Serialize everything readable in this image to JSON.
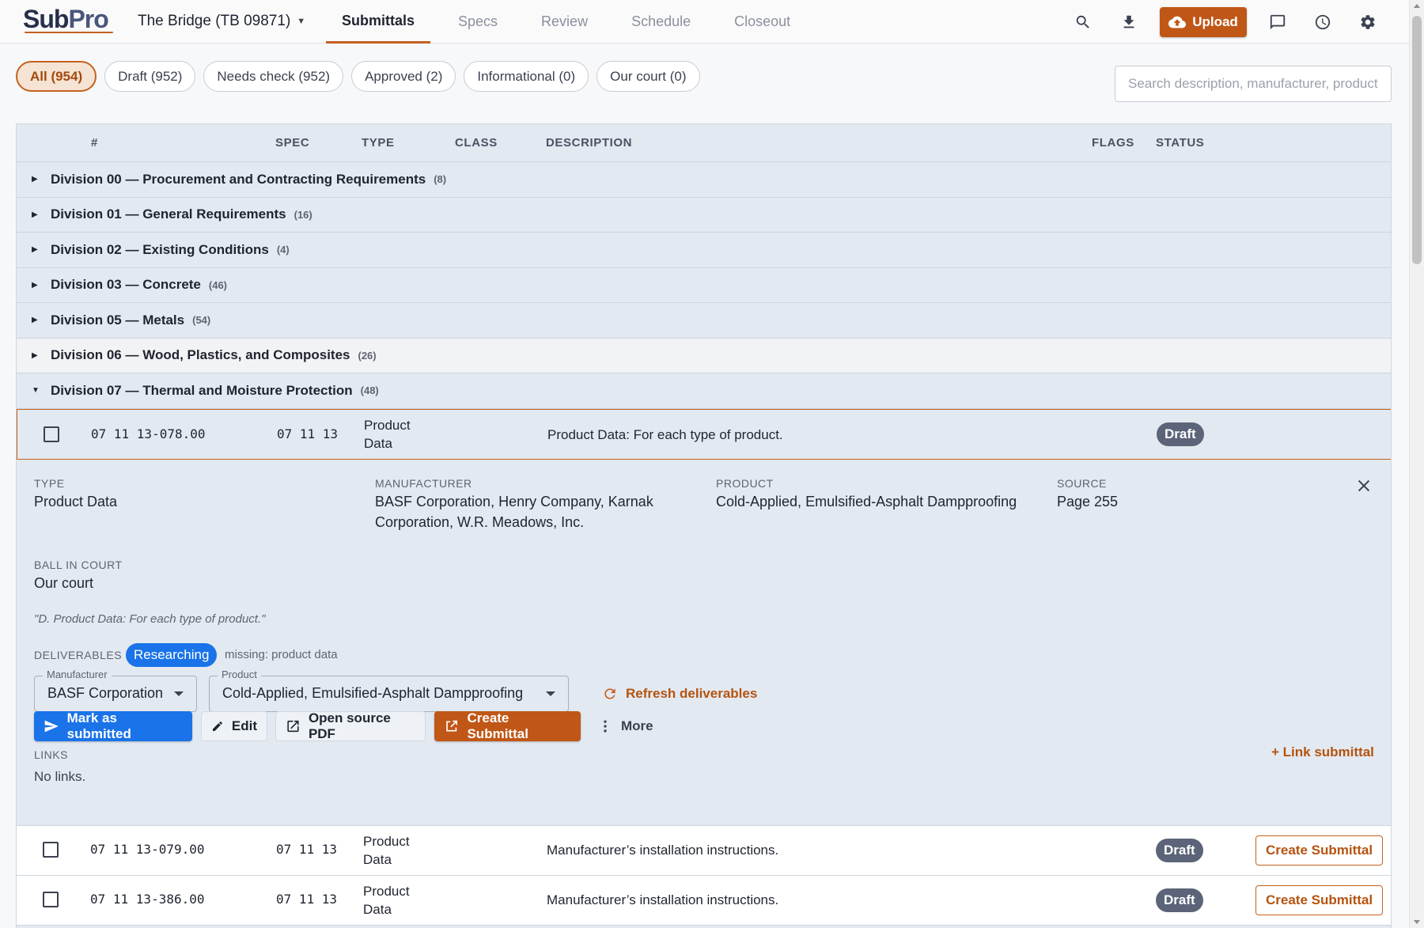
{
  "app": {
    "logo_main": "Sub",
    "logo_accent": "Pro",
    "project": "The Bridge (TB 09871)"
  },
  "nav": {
    "tabs": [
      {
        "label": "Submittals",
        "active": true
      },
      {
        "label": "Specs"
      },
      {
        "label": "Review"
      },
      {
        "label": "Schedule"
      },
      {
        "label": "Closeout"
      }
    ],
    "upload_label": "Upload",
    "icons": [
      "search-icon",
      "download-icon",
      "cloud-upload-icon",
      "comment-icon",
      "clock-icon",
      "gear-icon"
    ]
  },
  "filters": {
    "chips": [
      {
        "label": "All (954)",
        "active": true
      },
      {
        "label": "Draft (952)"
      },
      {
        "label": "Needs check (952)"
      },
      {
        "label": "Approved (2)"
      },
      {
        "label": "Informational (0)"
      },
      {
        "label": "Our court (0)"
      }
    ],
    "search_placeholder": "Search description, manufacturer, product"
  },
  "table": {
    "headers": {
      "number": "#",
      "spec": "SPEC",
      "type": "TYPE",
      "class": "CLASS",
      "description": "DESCRIPTION",
      "flags": "FLAGS",
      "status": "STATUS"
    },
    "divisions": [
      {
        "name": "Division 00 — Procurement and Contracting Requirements",
        "count": "(8)"
      },
      {
        "name": "Division 01 — General Requirements",
        "count": "(16)"
      },
      {
        "name": "Division 02 — Existing Conditions",
        "count": "(4)"
      },
      {
        "name": "Division 03 — Concrete",
        "count": "(46)"
      },
      {
        "name": "Division 05 — Metals",
        "count": "(54)"
      },
      {
        "name": "Division 06 — Wood, Plastics, and Composites",
        "count": "(26)"
      },
      {
        "name": "Division 07 — Thermal and Moisture Protection",
        "count": "(48)"
      }
    ],
    "rows": [
      {
        "number": "07 11 13-078.00",
        "spec": "07 11 13",
        "type_l1": "Product",
        "type_l2": "Data",
        "description": "Product Data: For each type of product.",
        "status": "Draft"
      },
      {
        "number": "07 11 13-079.00",
        "spec": "07 11 13",
        "type_l1": "Product",
        "type_l2": "Data",
        "description": "Manufacturer’s installation instructions.",
        "status": "Draft",
        "action": "Create Submittal"
      },
      {
        "number": "07 11 13-386.00",
        "spec": "07 11 13",
        "type_l1": "Product",
        "type_l2": "Data",
        "description": "Manufacturer’s installation instructions.",
        "status": "Draft",
        "action": "Create Submittal"
      }
    ]
  },
  "detail": {
    "type_label": "TYPE",
    "type_value": "Product Data",
    "manufacturer_label": "MANUFACTURER",
    "manufacturer_l1": "BASF Corporation, Henry Company, Karnak",
    "manufacturer_l2": "Corporation, W.R. Meadows, Inc.",
    "product_label": "PRODUCT",
    "product_value": "Cold-Applied, Emulsified-Asphalt Dampproofing",
    "source_label": "SOURCE",
    "source_value": "Page 255",
    "ball_label": "BALL IN COURT",
    "ball_value": "Our court",
    "quote": "\"D. Product Data: For each type of product.\"",
    "deliverables_label": "DELIVERABLES",
    "deliverables_status": "Researching",
    "missing": "missing: product data",
    "manufacturer_select_label": "Manufacturer",
    "manufacturer_select_value": "BASF Corporation",
    "product_select_label": "Product",
    "product_select_value": "Cold-Applied, Emulsified-Asphalt Dampproofing",
    "refresh_label": "Refresh deliverables",
    "actions": {
      "mark_submitted": "Mark as submitted",
      "edit": "Edit",
      "open_pdf": "Open source PDF",
      "create": "Create Submittal",
      "more": "More"
    },
    "links_label": "LINKS",
    "link_submittal": "+ Link submittal",
    "no_links": "No links."
  },
  "colors": {
    "accent": "#c05717",
    "primary": "#1a73e8",
    "badge": "#5b6478",
    "table_bg": "#e3e9f1"
  }
}
